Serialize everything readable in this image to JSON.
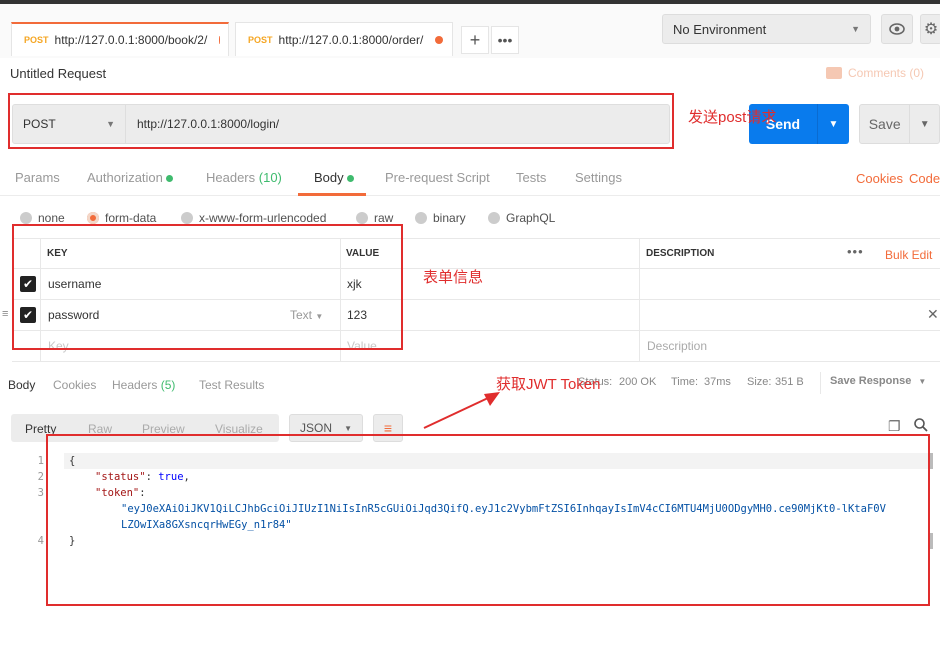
{
  "tabs": [
    {
      "method": "POST",
      "url": "http://127.0.0.1:8000/book/2/"
    },
    {
      "method": "POST",
      "url": "http://127.0.0.1:8000/order/"
    }
  ],
  "environment": {
    "selected": "No Environment"
  },
  "request": {
    "title": "Untitled Request",
    "comments_label": "Comments (0)",
    "method": "POST",
    "url": "http://127.0.0.1:8000/login/",
    "send_label": "Send",
    "save_label": "Save"
  },
  "request_tabs": {
    "params": "Params",
    "authorization": "Authorization",
    "headers": "Headers",
    "headers_count": "(10)",
    "body": "Body",
    "prerequest": "Pre-request Script",
    "tests": "Tests",
    "settings": "Settings",
    "cookies": "Cookies",
    "code": "Code"
  },
  "body_modes": {
    "none": "none",
    "form_data": "form-data",
    "urlencoded": "x-www-form-urlencoded",
    "raw": "raw",
    "binary": "binary",
    "graphql": "GraphQL"
  },
  "form_table": {
    "headers": {
      "key": "KEY",
      "value": "VALUE",
      "description": "DESCRIPTION",
      "bulk_edit": "Bulk Edit"
    },
    "rows": [
      {
        "key": "username",
        "value": "xjk",
        "type": ""
      },
      {
        "key": "password",
        "value": "123",
        "type": "Text"
      }
    ],
    "placeholder": {
      "key": "Key",
      "value": "Value",
      "description": "Description"
    }
  },
  "response_tabs": {
    "body": "Body",
    "cookies": "Cookies",
    "headers": "Headers",
    "headers_count": "(5)",
    "test_results": "Test Results"
  },
  "response_status": {
    "status_label": "Status:",
    "status_value": "200 OK",
    "time_label": "Time:",
    "time_value": "37ms",
    "size_label": "Size:",
    "size_value": "351 B",
    "save_response": "Save Response"
  },
  "view_modes": {
    "pretty": "Pretty",
    "raw": "Raw",
    "preview": "Preview",
    "visualize": "Visualize",
    "format": "JSON"
  },
  "response_json": {
    "line_numbers": [
      "1",
      "2",
      "3",
      "4"
    ],
    "open_brace": "{",
    "close_brace": "}",
    "status_key": "\"status\"",
    "status_value": "true",
    "token_key": "\"token\"",
    "token_value_line1": "\"eyJ0eXAiOiJKV1QiLCJhbGciOiJIUzI1NiIsInR5cGUiOiJqd3QifQ.eyJ1c2VybmFtZSI6InhqayIsImV4cCI6MTU4MjU0ODgyMH0.ce90MjKt0-lKtaF0V",
    "token_value_line2": "LZOwIXa8GXsncqrHwEGy_n1r84\""
  },
  "annotations": {
    "send_post": "发送post请求",
    "form_info": "表单信息",
    "get_token": "获取JWT Token"
  },
  "colors": {
    "accent": "#f26b3a",
    "send_button": "#097bed",
    "annotation_red": "#e02d2d",
    "status_green": "#3fbb6e"
  }
}
